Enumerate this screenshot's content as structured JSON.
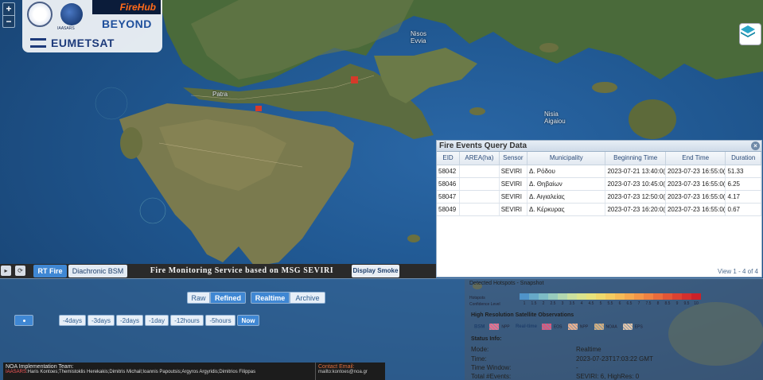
{
  "map": {
    "labels": [
      {
        "text": "Nisos",
        "sub": "Evvia"
      },
      {
        "text": "Patra"
      },
      {
        "text": "Nisia",
        "sub": "Aigaiou"
      }
    ]
  },
  "logos": {
    "iaasars": "IAASARS",
    "firehub": "FireHub",
    "beyond": "BEYOND",
    "eumetsat": "EUMETSAT"
  },
  "zoom": {
    "plus": "+",
    "minus": "−"
  },
  "query": {
    "title": "Fire Events Query Data",
    "close": "×",
    "columns": [
      "EID",
      "AREA(ha)",
      "Sensor",
      "Municipality",
      "Beginning Time",
      "End Time",
      "Duration"
    ],
    "rows": [
      [
        "58042",
        "",
        "SEVIRI",
        "Δ. Ρόδου",
        "2023-07-21 13:40:0(",
        "2023-07-23 16:55:0(",
        "51.33"
      ],
      [
        "58046",
        "",
        "SEVIRI",
        "Δ. Θηβαίων",
        "2023-07-23 10:45:0(",
        "2023-07-23 16:55:0(",
        "6.25"
      ],
      [
        "58047",
        "",
        "SEVIRI",
        "Δ. Αιγιαλείας",
        "2023-07-23 12:50:0(",
        "2023-07-23 16:55:0(",
        "4.17"
      ],
      [
        "58049",
        "",
        "SEVIRI",
        "Δ. Κέρκυρας",
        "2023-07-23 16:20:0(",
        "2023-07-23 16:55:0(",
        "0.67"
      ]
    ],
    "view_count": "View 1 - 4 of 4"
  },
  "toolbar": {
    "rt_fire": "RT Fire",
    "diachronic": "Diachronic BSM",
    "title": "Fire Monitoring Service based on MSG SEVIRI",
    "display_smoke": "Display Smoke"
  },
  "controls": {
    "mode_group": [
      "Raw",
      "Refined"
    ],
    "mode_selected": "Refined",
    "source_group": [
      "Realtime",
      "Archive"
    ],
    "source_selected": "Realtime",
    "ranges": [
      "-4days",
      "-3days",
      "-2days",
      "-1day",
      "-12hours",
      "-5hours",
      "Now"
    ],
    "range_selected": "Now"
  },
  "footer": {
    "team_title": "NOA Implementation Team:",
    "team_org": "IAASARS",
    "team_members": ":Haris Kontoes;Themistoklis Herekakis;Dimitris Michail;Ioannis Papoutsis;Argyros Argyridis;Dimitrios Filippas",
    "contact_title": "Contact Email:",
    "contact_email": "mailto:kontoes@noa.gr"
  },
  "info": {
    "hotspots_title": "Detected Hotspots - Snapshot",
    "hotspots_label": "Hotspots",
    "confidence_label": "Confidence Level",
    "confidence_ticks": [
      "1",
      "1.5",
      "2",
      "2.5",
      "3",
      "3.5",
      "4",
      "4.5",
      "5",
      "5.5",
      "6",
      "6.5",
      "7",
      "7.5",
      "8",
      "8.5",
      "9",
      "9.5",
      "10"
    ],
    "confidence_colors": [
      "#4f93c9",
      "#66a9c8",
      "#7dbcc6",
      "#97cbbd",
      "#b2d7b0",
      "#cbe09f",
      "#dbe48d",
      "#e7e37c",
      "#efd96c",
      "#f4cb60",
      "#f6bb57",
      "#f6a94f",
      "#f49648",
      "#f08242",
      "#ea6c3c",
      "#e35636",
      "#dc4231",
      "#d4302d",
      "#cc2129"
    ],
    "hr_title": "High Resolution Satellite Observations",
    "legend": [
      {
        "label": "BSM",
        "color": "#f06a8c",
        "name": "NPP"
      },
      {
        "label": "Real-time",
        "color": "#e0507a",
        "name": "EOS"
      },
      {
        "color": "#f0b08c",
        "name": "NPP"
      },
      {
        "color": "#d8b07a",
        "name": "NOAA"
      },
      {
        "color": "#e8c8a8",
        "name": "EPS"
      }
    ],
    "status_title": "Status Info:",
    "status": [
      {
        "key": "Mode:",
        "value": "Realtime"
      },
      {
        "key": "Time:",
        "value": "2023-07-23T17:03:22 GMT"
      },
      {
        "key": "Time Window:",
        "value": "-"
      },
      {
        "key": "Total #Events:",
        "value": "SEVIRI: 6, HighRes: 0"
      }
    ]
  }
}
